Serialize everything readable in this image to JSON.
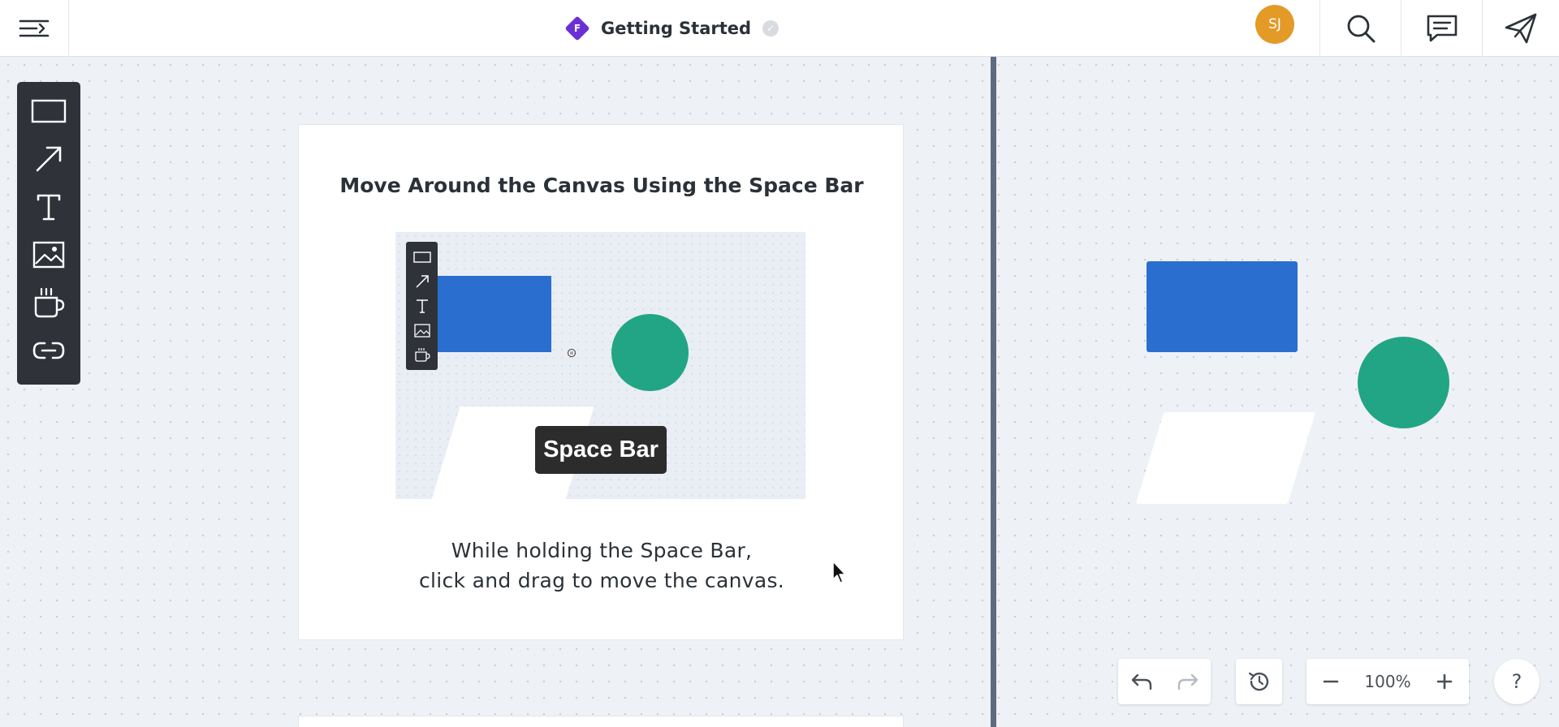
{
  "header": {
    "doc_badge_letter": "F",
    "doc_title": "Getting Started",
    "avatar_initials": "SJ"
  },
  "toolbar": {
    "tools": [
      "rectangle-tool",
      "arrow-tool",
      "text-tool",
      "image-tool",
      "cup-tool",
      "link-tool"
    ]
  },
  "card": {
    "title": "Move Around the Canvas Using the Space Bar",
    "key_label": "Space Bar",
    "description_line1": "While holding the Space Bar,",
    "description_line2": "click and drag to move the canvas."
  },
  "controls": {
    "zoom_level": "100%",
    "help_label": "?"
  },
  "colors": {
    "accent_purple": "#6b2fd6",
    "avatar_orange": "#e39a27",
    "shape_blue": "#2a6fcf",
    "shape_green": "#22a585",
    "toolbar_dark": "#2f3339"
  }
}
